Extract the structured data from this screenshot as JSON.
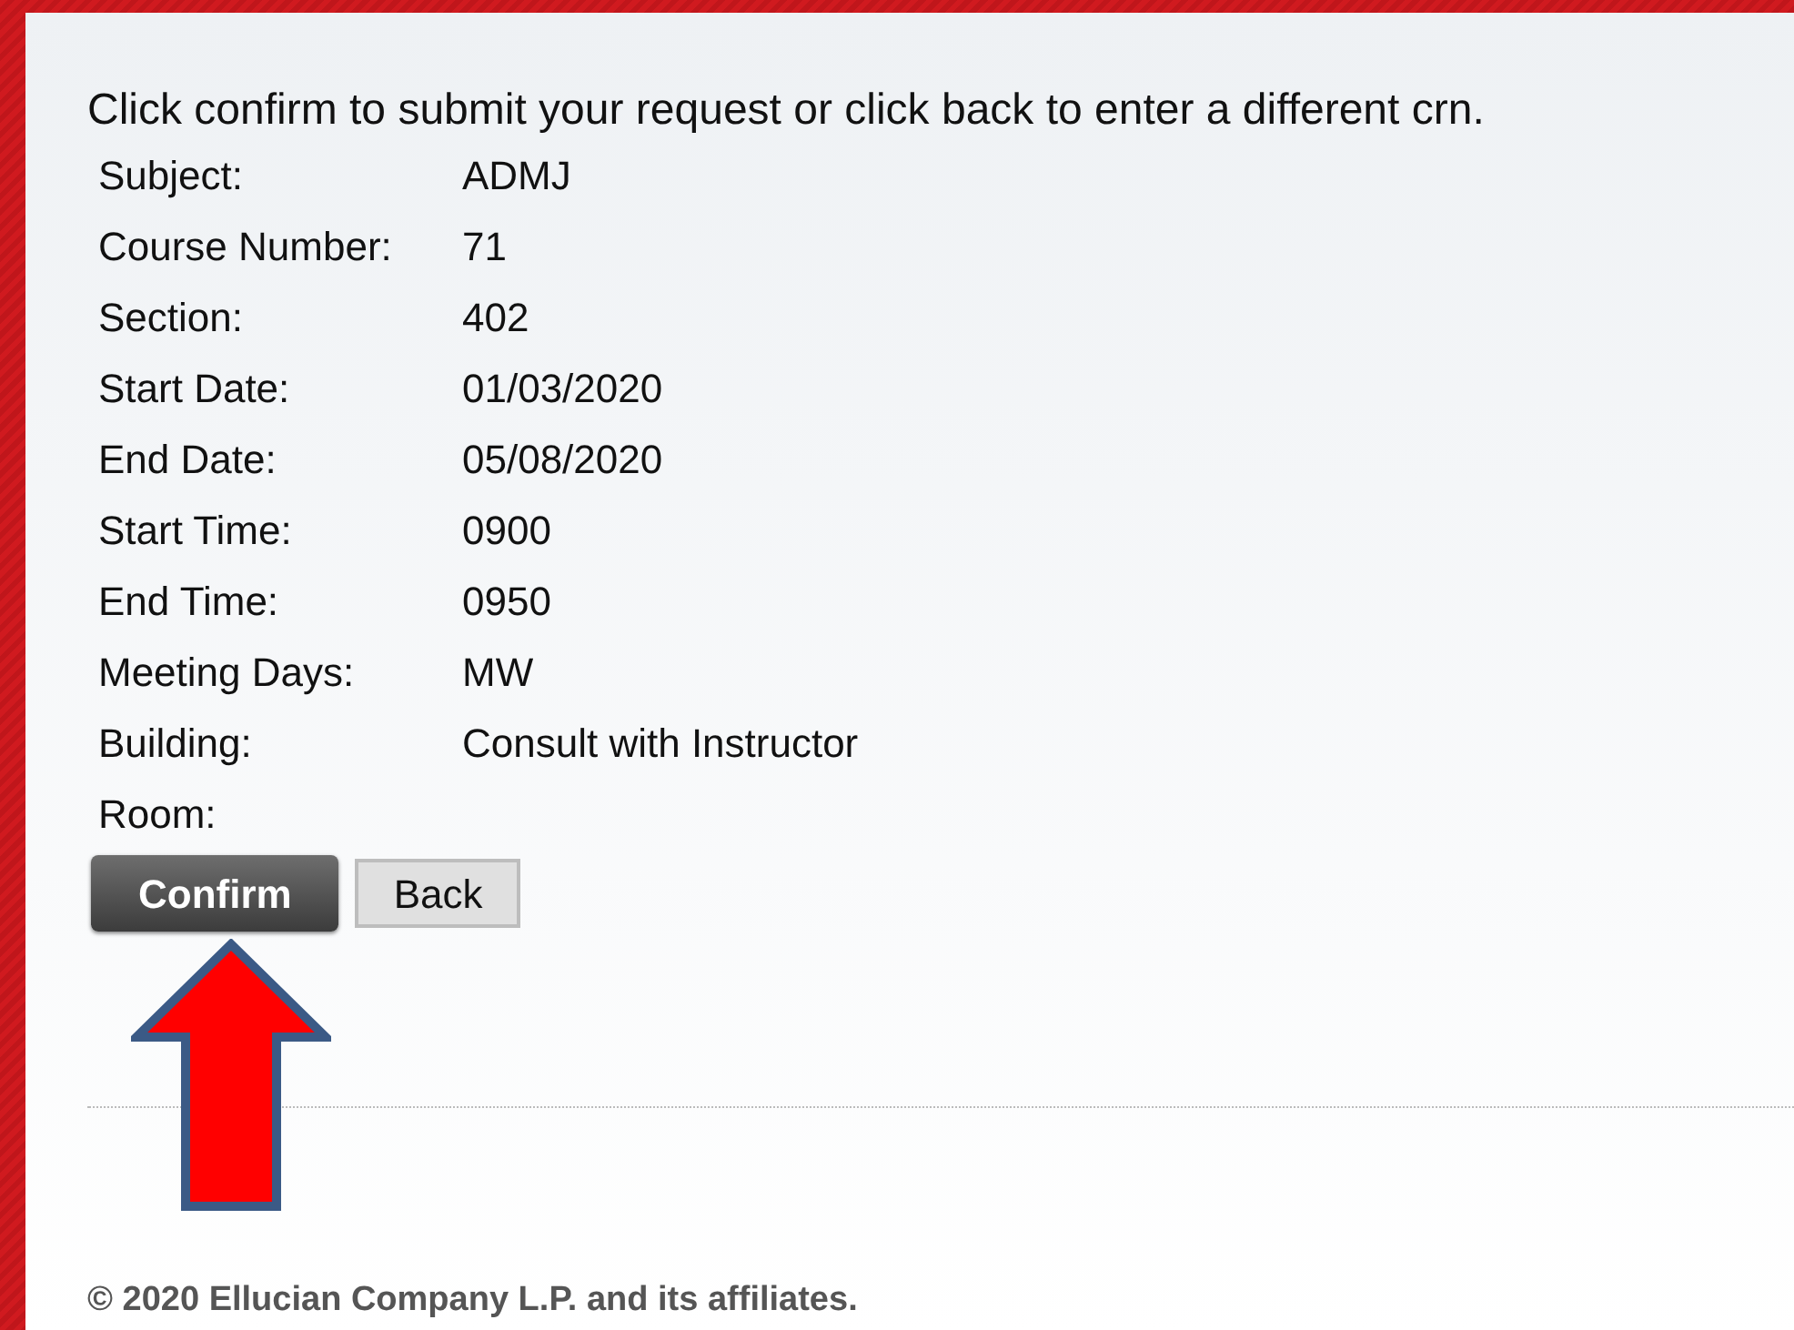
{
  "instruction": "Click confirm to submit your request or click back to enter a different crn.",
  "details": [
    {
      "label": "Subject:",
      "value": "ADMJ"
    },
    {
      "label": "Course Number:",
      "value": "71"
    },
    {
      "label": "Section:",
      "value": "402"
    },
    {
      "label": "Start Date:",
      "value": "01/03/2020"
    },
    {
      "label": "End Date:",
      "value": "05/08/2020"
    },
    {
      "label": "Start Time:",
      "value": "0900"
    },
    {
      "label": "End Time:",
      "value": "0950"
    },
    {
      "label": "Meeting Days:",
      "value": "MW"
    },
    {
      "label": "Building:",
      "value": "Consult with Instructor"
    },
    {
      "label": "Room:"
    }
  ],
  "buttons": [
    {
      "label": "Confirm",
      "kind": "primary"
    },
    {
      "label": "Back",
      "kind": "secondary"
    }
  ],
  "footer": "© 2020 Ellucian Company L.P. and its affiliates."
}
